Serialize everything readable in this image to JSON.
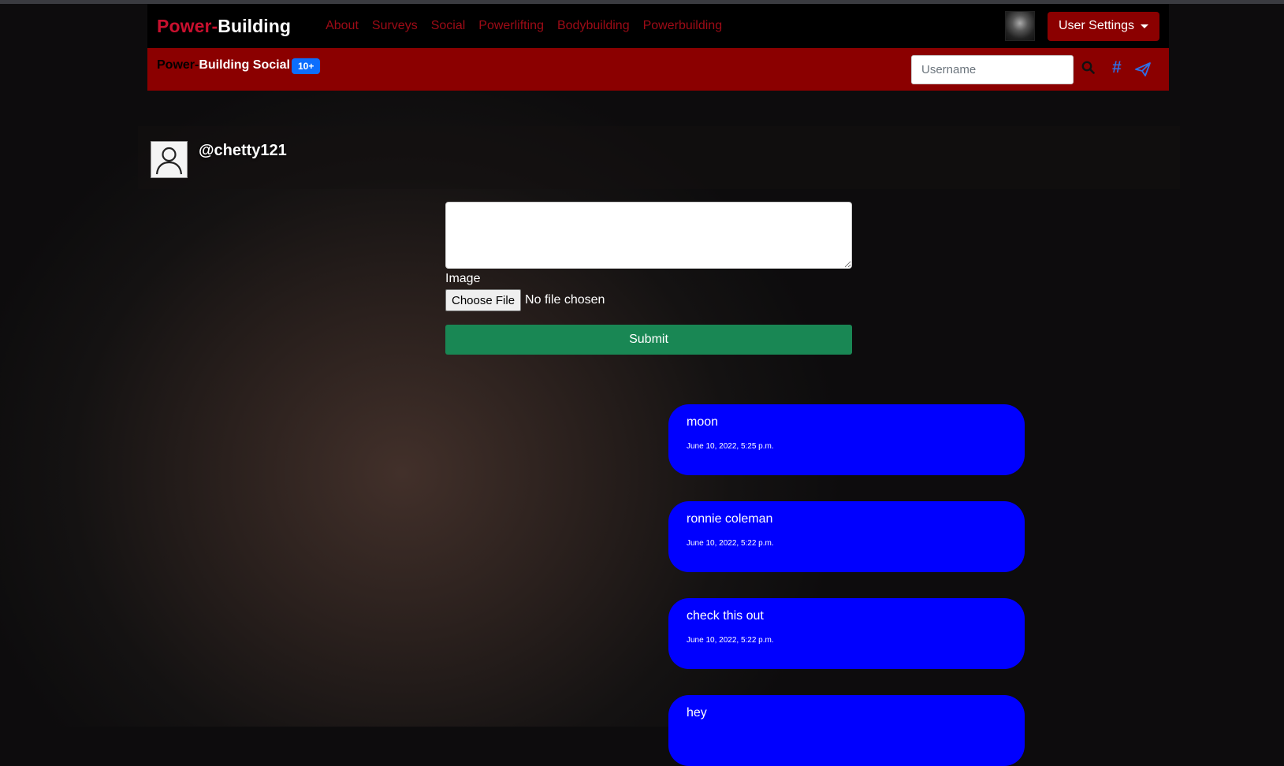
{
  "navbar": {
    "brand_part1": "Power-",
    "brand_part2": "Building",
    "links": [
      "About",
      "Surveys",
      "Social",
      "Powerlifting",
      "Bodybuilding",
      "Powerbuilding"
    ],
    "settings_label": "User Settings"
  },
  "subbar": {
    "brand_part1": "Power-",
    "brand_part2": "Building Social",
    "badge": "10+",
    "search_placeholder": "Username",
    "hash_symbol": "#"
  },
  "profile": {
    "handle": "@chetty121"
  },
  "form": {
    "image_label": "Image",
    "file_button": "Choose File",
    "file_status": "No file chosen",
    "submit_label": "Submit"
  },
  "posts": [
    {
      "text": "moon",
      "date": "June 10, 2022, 5:25 p.m."
    },
    {
      "text": "ronnie coleman",
      "date": "June 10, 2022, 5:22 p.m."
    },
    {
      "text": "check this out",
      "date": "June 10, 2022, 5:22 p.m."
    },
    {
      "text": "hey",
      "date": ""
    }
  ],
  "colors": {
    "navbar_bg": "#000000",
    "subbar_bg": "#8b0000",
    "post_bg": "#0000ff",
    "submit_bg": "#198754",
    "badge_bg": "#0d6efd"
  },
  "icons": [
    "search-icon",
    "hash-icon",
    "send-icon",
    "user-avatar-icon",
    "chevron-down-icon"
  ]
}
